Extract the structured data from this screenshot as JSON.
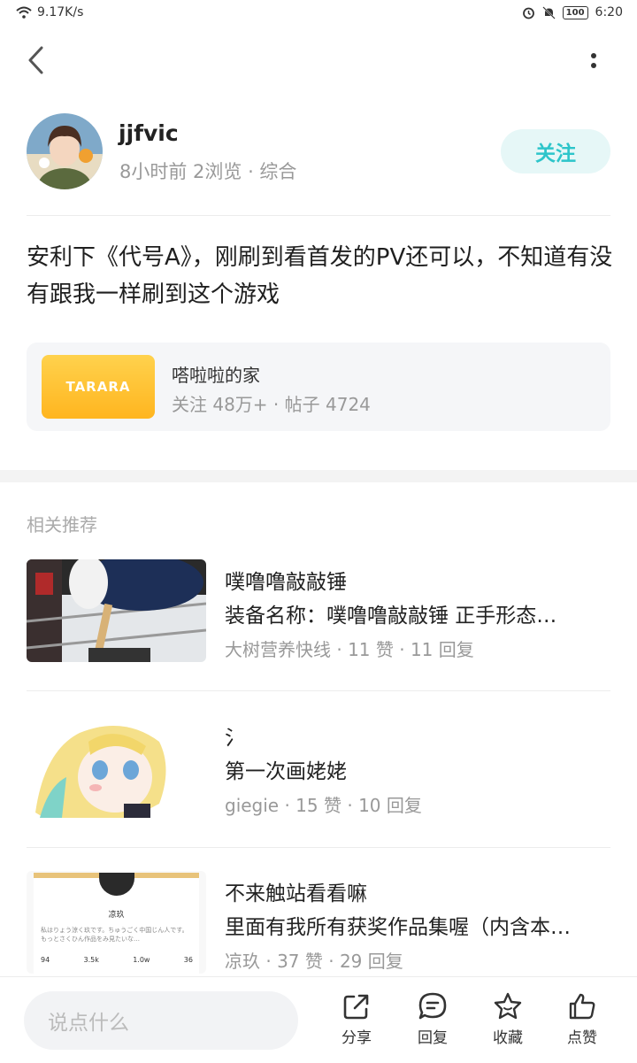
{
  "status_bar": {
    "network_speed": "9.17K/s",
    "battery": "100",
    "time": "6:20"
  },
  "author": {
    "name": "jjfvic",
    "meta": "8小时前  2浏览 · 综合",
    "follow_label": "关注"
  },
  "post": {
    "text": "安利下《代号A》，刚刷到看首发的PV还可以，不知道有没有跟我一样刷到这个游戏"
  },
  "circle": {
    "logo_text": "TARARA",
    "name": "嗒啦啦的家",
    "stats": "关注 48万+  ·  帖子 4724"
  },
  "section_title": "相关推荐",
  "recommendations": [
    {
      "title": "噗噜噜敲敲锤",
      "desc": "装备名称：噗噜噜敲敲锤 正手形态…",
      "meta": "大树营养快线 · 11 赞 · 11 回复"
    },
    {
      "title": "氵",
      "desc": "第一次画姥姥",
      "meta": "giegie · 15 赞 · 10 回复"
    },
    {
      "title": "不来触站看看嘛",
      "desc": "里面有我所有获奖作品集喔（内含本…",
      "meta": "凉玖 · 37 赞 · 29 回复",
      "thumb_card": {
        "name": "凉玖",
        "bio": "私はりょう涼く玖です。ちゅうごく中国じん人です。もっとさくひん作品をみ見たいな…",
        "stats": [
          "94",
          "3.5k",
          "1.0w",
          "36"
        ]
      }
    }
  ],
  "bottom_bar": {
    "input_placeholder": "说点什么",
    "actions": [
      {
        "label": "分享",
        "icon": "share-icon"
      },
      {
        "label": "回复",
        "icon": "comment-icon"
      },
      {
        "label": "收藏",
        "icon": "star-icon"
      },
      {
        "label": "点赞",
        "icon": "thumbs-up-icon"
      }
    ]
  }
}
